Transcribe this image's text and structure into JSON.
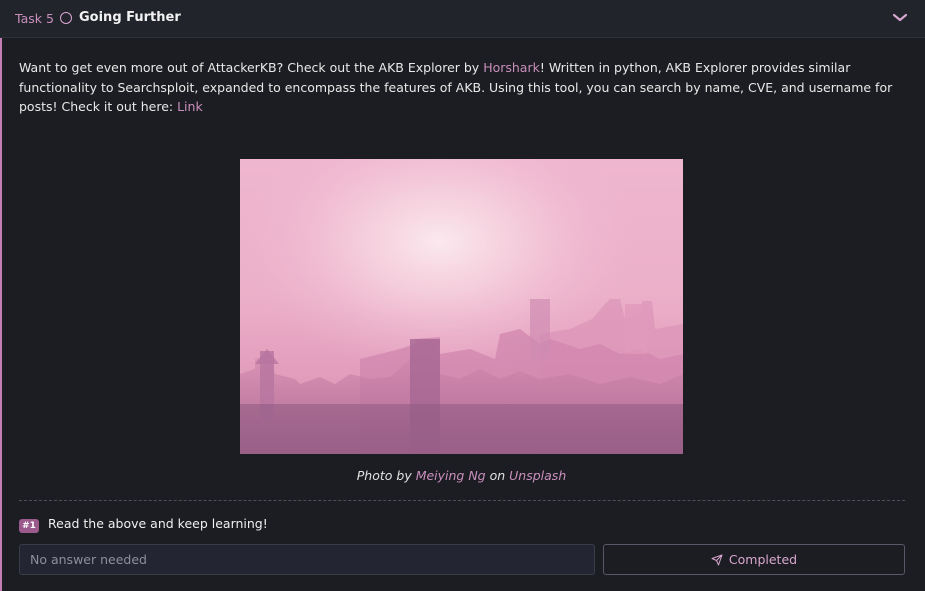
{
  "task": {
    "number_label": "Task 5",
    "title": "Going Further"
  },
  "body": {
    "p1": "Want to get even more out of AttackerKB? Check out the AKB Explorer by ",
    "author_link": "Horshark",
    "p2": "! Written in python, AKB Explorer provides similar functionality to Searchsploit, expanded to encompass the features of AKB. Using this tool, you can search by name, CVE, and username for posts! Check it out here: ",
    "link_text": "Link"
  },
  "photo": {
    "caption_prefix": "Photo by ",
    "photographer": "Meiying Ng",
    "caption_mid": " on ",
    "source": "Unsplash"
  },
  "question": {
    "badge": "#1",
    "text": "Read the above and keep learning!",
    "answer_placeholder": "No answer needed",
    "button_label": "Completed"
  },
  "colors": {
    "accent": "#c98fbd",
    "background": "#1c1d22"
  }
}
